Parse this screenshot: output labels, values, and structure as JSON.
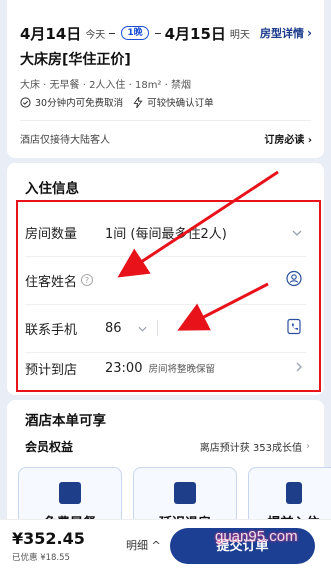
{
  "booking": {
    "checkin_date": "4月14日",
    "checkin_day": "今天",
    "nights": "1晚",
    "checkout_date": "4月15日",
    "checkout_day": "明天",
    "room_detail_label": "房型详情",
    "room_name": "大床房[华住正价]",
    "room_attrs": "大床 · 无早餐 · 2人入住 · 18m² · 禁烟",
    "policy_cancel": "30分钟内可免费取消",
    "policy_confirm": "可较快确认订单",
    "notice": "酒店仅接待大陆客人",
    "must_read": "订房必读"
  },
  "guest_info": {
    "title": "入住信息",
    "rooms_label": "房间数量",
    "rooms_value": "1间 (每间最多住2人)",
    "name_label": "住客姓名",
    "name_help": "?",
    "phone_label": "联系手机",
    "phone_code": "86",
    "arrival_label": "预计到店",
    "arrival_time": "23:00",
    "arrival_note": "房间将整晚保留"
  },
  "benefits": {
    "title": "酒店本单可享",
    "member_label": "会员权益",
    "growth_text": "离店预计获 353成长值",
    "tiles": [
      "免费早餐",
      "延迟退房",
      "提前入住"
    ]
  },
  "bottom": {
    "price": "¥352.45",
    "discount": "已优惠 ¥18.55",
    "detail": "明细",
    "submit": "提交订单",
    "watermark": "guan95.com"
  },
  "colors": {
    "accent": "#1c3f93",
    "annotation": "#e8121b"
  }
}
